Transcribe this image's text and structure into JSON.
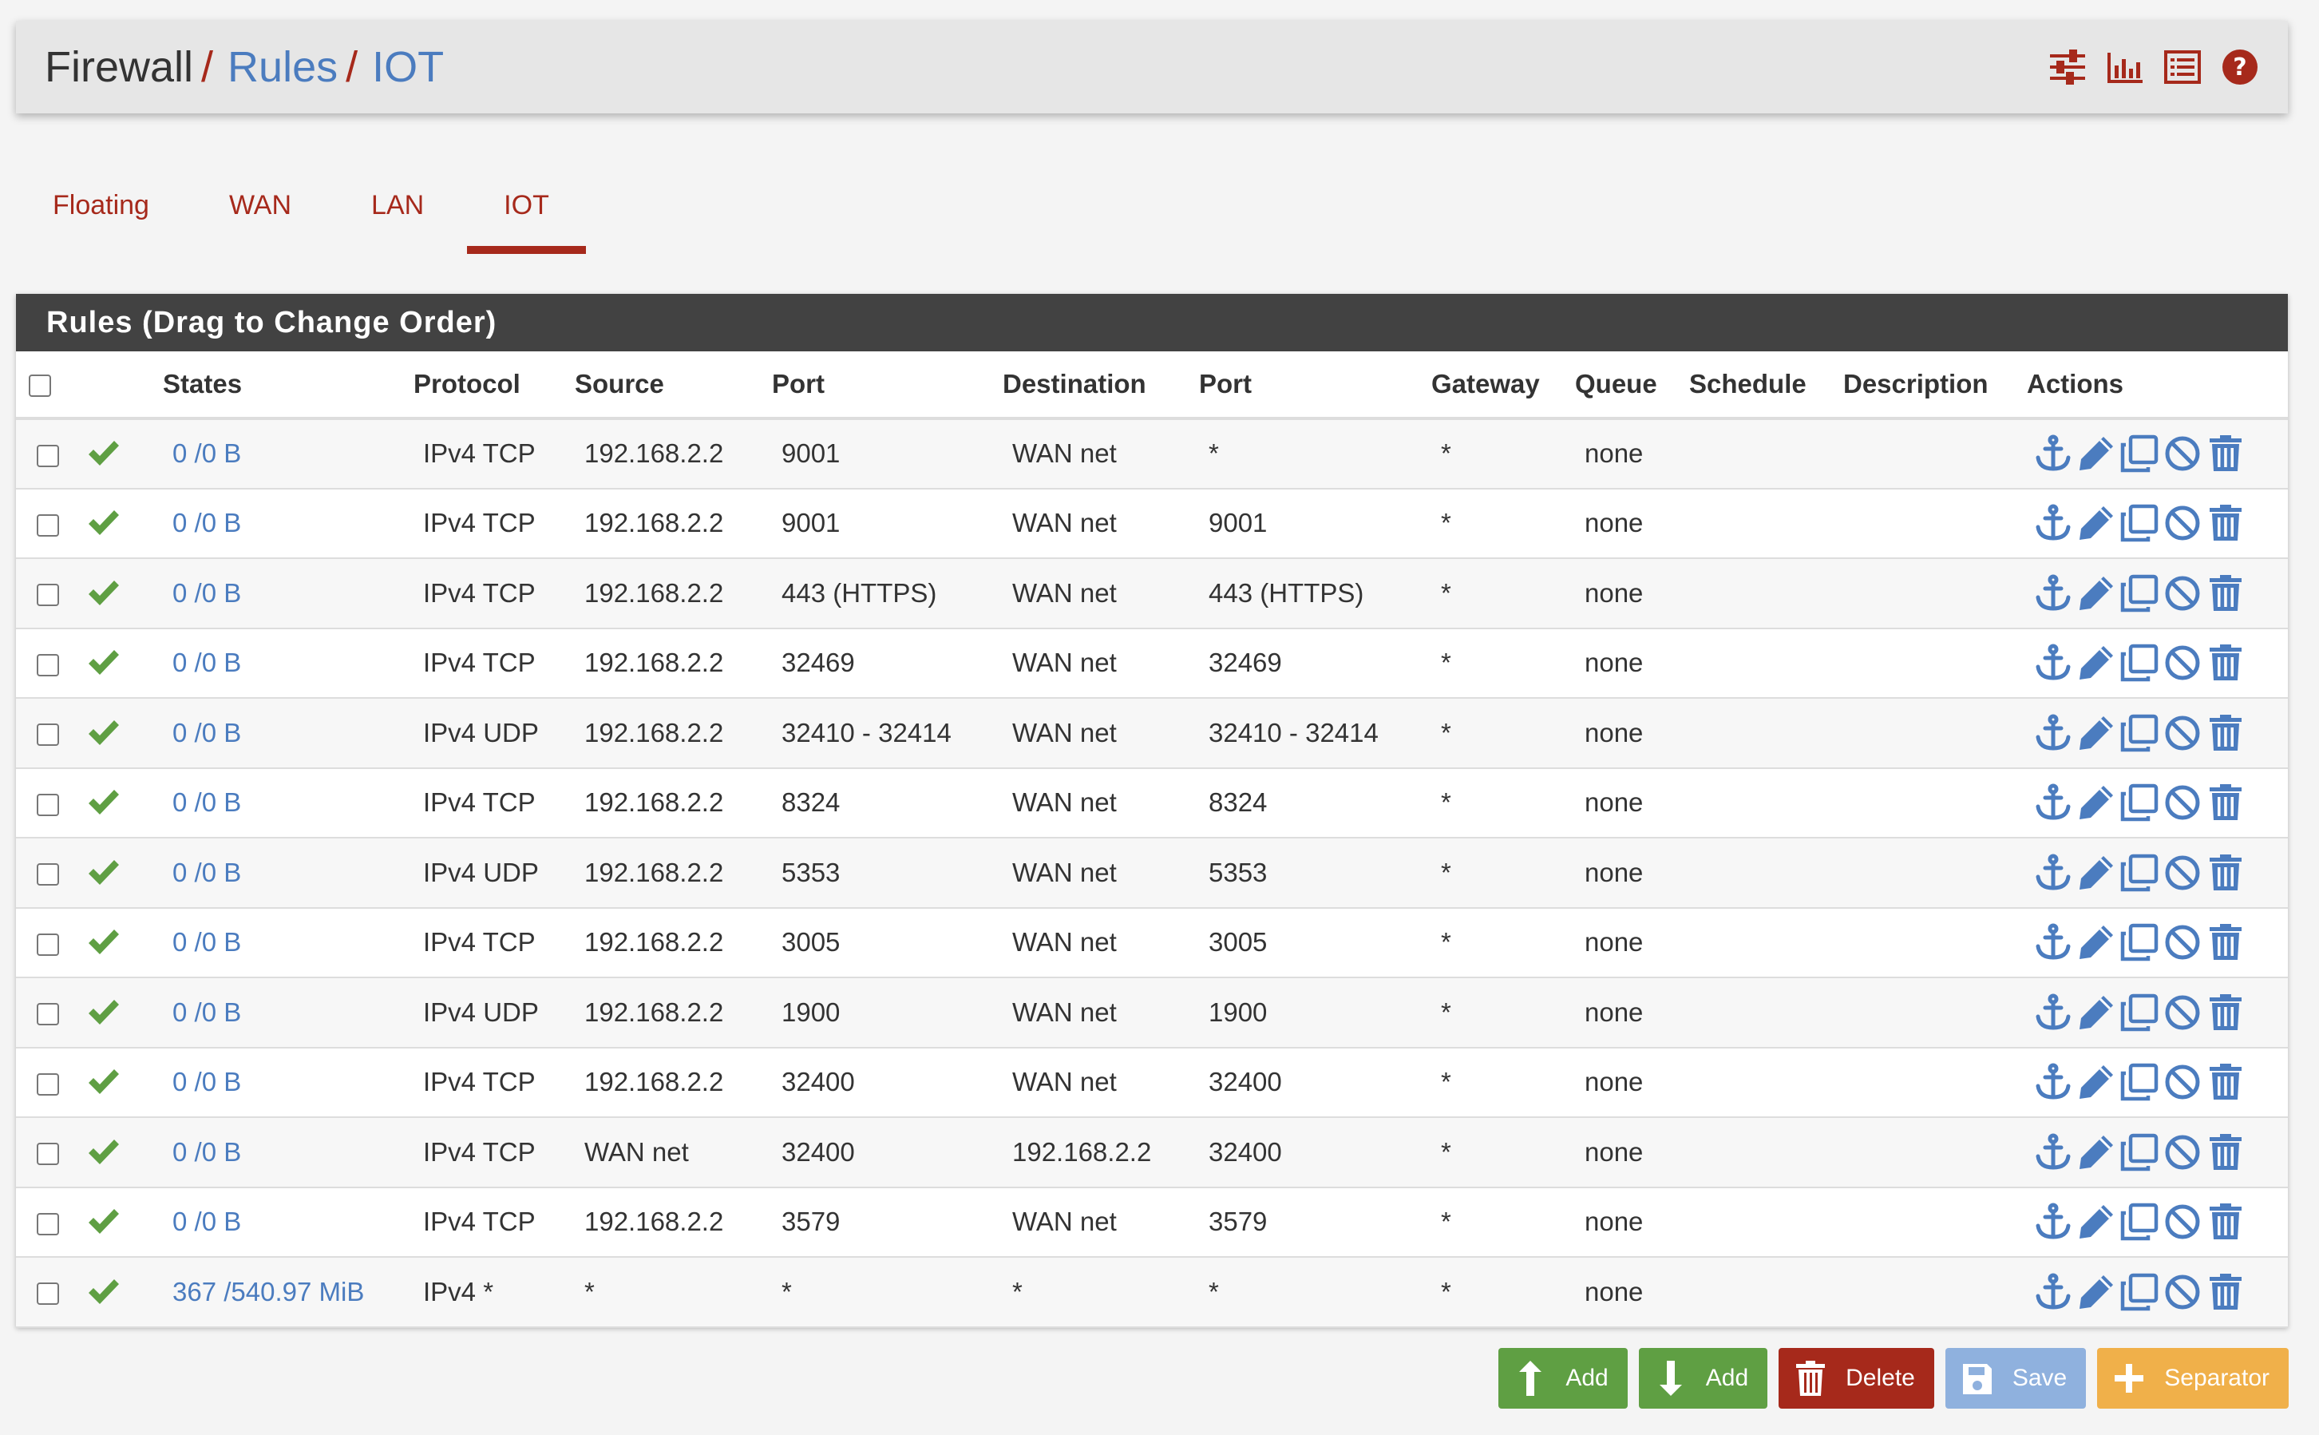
{
  "breadcrumb": {
    "home": "Firewall",
    "sep1": "/",
    "rules": "Rules",
    "sep2": "/",
    "current": "IOT"
  },
  "header_icons": [
    "sliders-icon",
    "bar-chart-icon",
    "list-icon",
    "help-icon"
  ],
  "tabs": [
    {
      "label": "Floating",
      "active": false
    },
    {
      "label": "WAN",
      "active": false
    },
    {
      "label": "LAN",
      "active": false
    },
    {
      "label": "IOT",
      "active": true
    }
  ],
  "panel": {
    "title": "Rules (Drag to Change Order)"
  },
  "columns": {
    "states": "States",
    "protocol": "Protocol",
    "source": "Source",
    "source_port": "Port",
    "destination": "Destination",
    "dest_port": "Port",
    "gateway": "Gateway",
    "queue": "Queue",
    "schedule": "Schedule",
    "description": "Description",
    "actions": "Actions"
  },
  "rows": [
    {
      "states": "0 /0 B",
      "protocol": "IPv4 TCP",
      "source": "192.168.2.2",
      "sport": "9001",
      "destination": "WAN net",
      "dport": "*",
      "gateway": "*",
      "queue": "none"
    },
    {
      "states": "0 /0 B",
      "protocol": "IPv4 TCP",
      "source": "192.168.2.2",
      "sport": "9001",
      "destination": "WAN net",
      "dport": "9001",
      "gateway": "*",
      "queue": "none"
    },
    {
      "states": "0 /0 B",
      "protocol": "IPv4 TCP",
      "source": "192.168.2.2",
      "sport": "443 (HTTPS)",
      "destination": "WAN net",
      "dport": "443 (HTTPS)",
      "gateway": "*",
      "queue": "none"
    },
    {
      "states": "0 /0 B",
      "protocol": "IPv4 TCP",
      "source": "192.168.2.2",
      "sport": "32469",
      "destination": "WAN net",
      "dport": "32469",
      "gateway": "*",
      "queue": "none"
    },
    {
      "states": "0 /0 B",
      "protocol": "IPv4 UDP",
      "source": "192.168.2.2",
      "sport": "32410 - 32414",
      "destination": "WAN net",
      "dport": "32410 - 32414",
      "gateway": "*",
      "queue": "none"
    },
    {
      "states": "0 /0 B",
      "protocol": "IPv4 TCP",
      "source": "192.168.2.2",
      "sport": "8324",
      "destination": "WAN net",
      "dport": "8324",
      "gateway": "*",
      "queue": "none"
    },
    {
      "states": "0 /0 B",
      "protocol": "IPv4 UDP",
      "source": "192.168.2.2",
      "sport": "5353",
      "destination": "WAN net",
      "dport": "5353",
      "gateway": "*",
      "queue": "none"
    },
    {
      "states": "0 /0 B",
      "protocol": "IPv4 TCP",
      "source": "192.168.2.2",
      "sport": "3005",
      "destination": "WAN net",
      "dport": "3005",
      "gateway": "*",
      "queue": "none"
    },
    {
      "states": "0 /0 B",
      "protocol": "IPv4 UDP",
      "source": "192.168.2.2",
      "sport": "1900",
      "destination": "WAN net",
      "dport": "1900",
      "gateway": "*",
      "queue": "none"
    },
    {
      "states": "0 /0 B",
      "protocol": "IPv4 TCP",
      "source": "192.168.2.2",
      "sport": "32400",
      "destination": "WAN net",
      "dport": "32400",
      "gateway": "*",
      "queue": "none"
    },
    {
      "states": "0 /0 B",
      "protocol": "IPv4 TCP",
      "source": "WAN net",
      "sport": "32400",
      "destination": "192.168.2.2",
      "dport": "32400",
      "gateway": "*",
      "queue": "none"
    },
    {
      "states": "0 /0 B",
      "protocol": "IPv4 TCP",
      "source": "192.168.2.2",
      "sport": "3579",
      "destination": "WAN net",
      "dport": "3579",
      "gateway": "*",
      "queue": "none"
    },
    {
      "states": "367 /540.97 MiB",
      "protocol": "IPv4 *",
      "source": "*",
      "sport": "*",
      "destination": "*",
      "dport": "*",
      "gateway": "*",
      "queue": "none"
    }
  ],
  "row_action_icons": [
    "anchor-icon",
    "pencil-icon",
    "copy-icon",
    "disable-icon",
    "trash-icon"
  ],
  "buttons": [
    {
      "label": "Add",
      "name": "add-top-button",
      "icon": "arrow-up-icon",
      "variant": "green"
    },
    {
      "label": "Add",
      "name": "add-bottom-button",
      "icon": "arrow-down-icon",
      "variant": "green"
    },
    {
      "label": "Delete",
      "name": "delete-button",
      "icon": "trash-icon",
      "variant": "red"
    },
    {
      "label": "Save",
      "name": "save-button",
      "icon": "floppy-icon",
      "variant": "blue"
    },
    {
      "label": "Separator",
      "name": "separator-button",
      "icon": "plus-icon",
      "variant": "orange"
    }
  ],
  "colors": {
    "accent_red": "#a6291b",
    "link_blue": "#4b7cbf",
    "check_green": "#5f9f43",
    "panel_heading": "#424242"
  }
}
